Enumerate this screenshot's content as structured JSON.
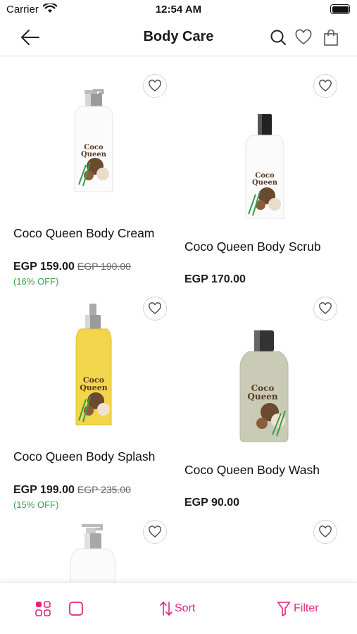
{
  "status_bar": {
    "carrier": "Carrier",
    "time": "12:54 AM"
  },
  "nav": {
    "title": "Body Care"
  },
  "products": [
    {
      "name": "Coco Queen Body Cream",
      "price": "EGP 159.00",
      "old_price": "EGP 190.00",
      "discount": "(16% OFF)"
    },
    {
      "name": "Coco Queen Body Scrub",
      "price": "EGP 170.00"
    },
    {
      "name": "Coco Queen Body Splash",
      "price": "EGP 199.00",
      "old_price": "EGP 235.00",
      "discount": "(15% OFF)"
    },
    {
      "name": "Coco Queen Body Wash",
      "price": "EGP 90.00"
    }
  ],
  "bottom_bar": {
    "sort_label": "Sort",
    "filter_label": "Filter"
  },
  "colors": {
    "accent": "#e0257d",
    "discount": "#3aa24a"
  }
}
